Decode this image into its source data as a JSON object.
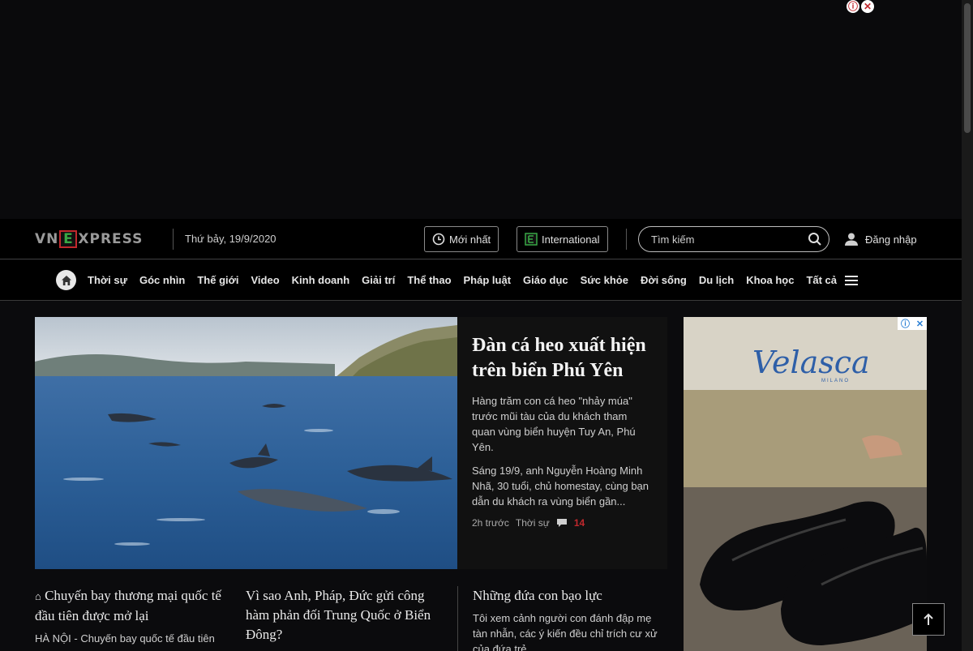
{
  "header": {
    "logo": {
      "left": "VN",
      "e": "E",
      "right": "XPRESS"
    },
    "date": "Thứ bảy, 19/9/2020",
    "latest_label": "Mới nhất",
    "international_label": "International",
    "search_placeholder": "Tìm kiếm",
    "login_label": "Đăng nhập"
  },
  "nav": {
    "items": [
      "Thời sự",
      "Góc nhìn",
      "Thế giới",
      "Video",
      "Kinh doanh",
      "Giải trí",
      "Thể thao",
      "Pháp luật",
      "Giáo dục",
      "Sức khỏe",
      "Đời sống",
      "Du lịch",
      "Khoa học",
      "Tất cả"
    ]
  },
  "hero": {
    "title": "Đàn cá heo xuất hiện trên biển Phú Yên",
    "desc1": "Hàng trăm con cá heo \"nhảy múa\" trước mũi tàu của du khách tham quan vùng biển huyện Tuy An, Phú Yên.",
    "desc2": "Sáng 19/9, anh Nguyễn Hoàng Minh Nhã, 30 tuổi, chủ homestay, cùng bạn dẫn du khách ra vùng biển gần...",
    "time": "2h trước",
    "category": "Thời sự",
    "comments": "14"
  },
  "side_ad": {
    "brand": "Velasca",
    "sub": "MILANO"
  },
  "cards": [
    {
      "title": "Chuyến bay thương mại quốc tế đầu tiên được mở lại",
      "desc": "HÀ NỘI - Chuyến bay quốc tế đầu tiên"
    },
    {
      "title": "Vì sao Anh, Pháp, Đức gửi công hàm phản đối Trung Quốc ở Biển Đông?"
    },
    {
      "title": "Những đứa con bạo lực",
      "desc": "Tôi xem cảnh người con đánh đập mẹ tàn nhẫn, các ý kiến đều chỉ trích cư xử của đứa trẻ..."
    }
  ],
  "colors": {
    "accent_red": "#c0282d",
    "accent_green": "#39a845"
  }
}
